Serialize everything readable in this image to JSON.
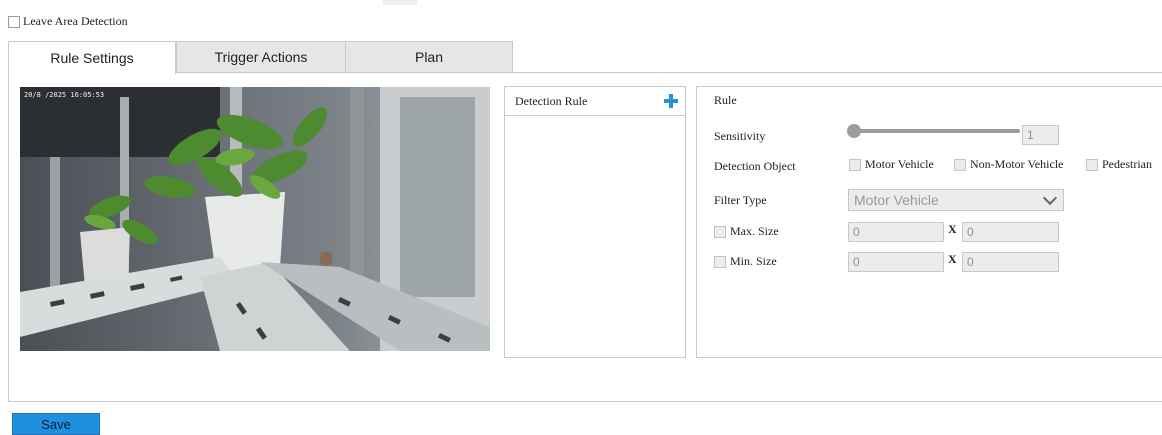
{
  "enable": {
    "label": "Leave Area Detection",
    "checked": false
  },
  "tabs": [
    {
      "label": "Rule Settings",
      "active": true
    },
    {
      "label": "Trigger Actions",
      "active": false
    },
    {
      "label": "Plan",
      "active": false
    }
  ],
  "video": {
    "osd_timestamp": "20/8 /2025 16:05:53"
  },
  "rule_list": {
    "header": "Detection Rule",
    "add_icon": "plus-icon"
  },
  "rule_settings": {
    "title": "Rule",
    "sensitivity": {
      "label": "Sensitivity",
      "value": "1"
    },
    "detection_object": {
      "label": "Detection Object",
      "options": [
        "Motor Vehicle",
        "Non-Motor Vehicle",
        "Pedestrian"
      ]
    },
    "filter_type": {
      "label": "Filter Type",
      "value": "Motor Vehicle"
    },
    "max_size": {
      "label": "Max. Size",
      "w": "0",
      "x_sep": "X",
      "h": "0"
    },
    "min_size": {
      "label": "Min. Size",
      "w": "0",
      "x_sep": "X",
      "h": "0"
    }
  },
  "save_label": "Save",
  "colors": {
    "accent": "#1f8fe0",
    "plus": "#2a8fd8",
    "disabled_bg": "#ececec"
  }
}
